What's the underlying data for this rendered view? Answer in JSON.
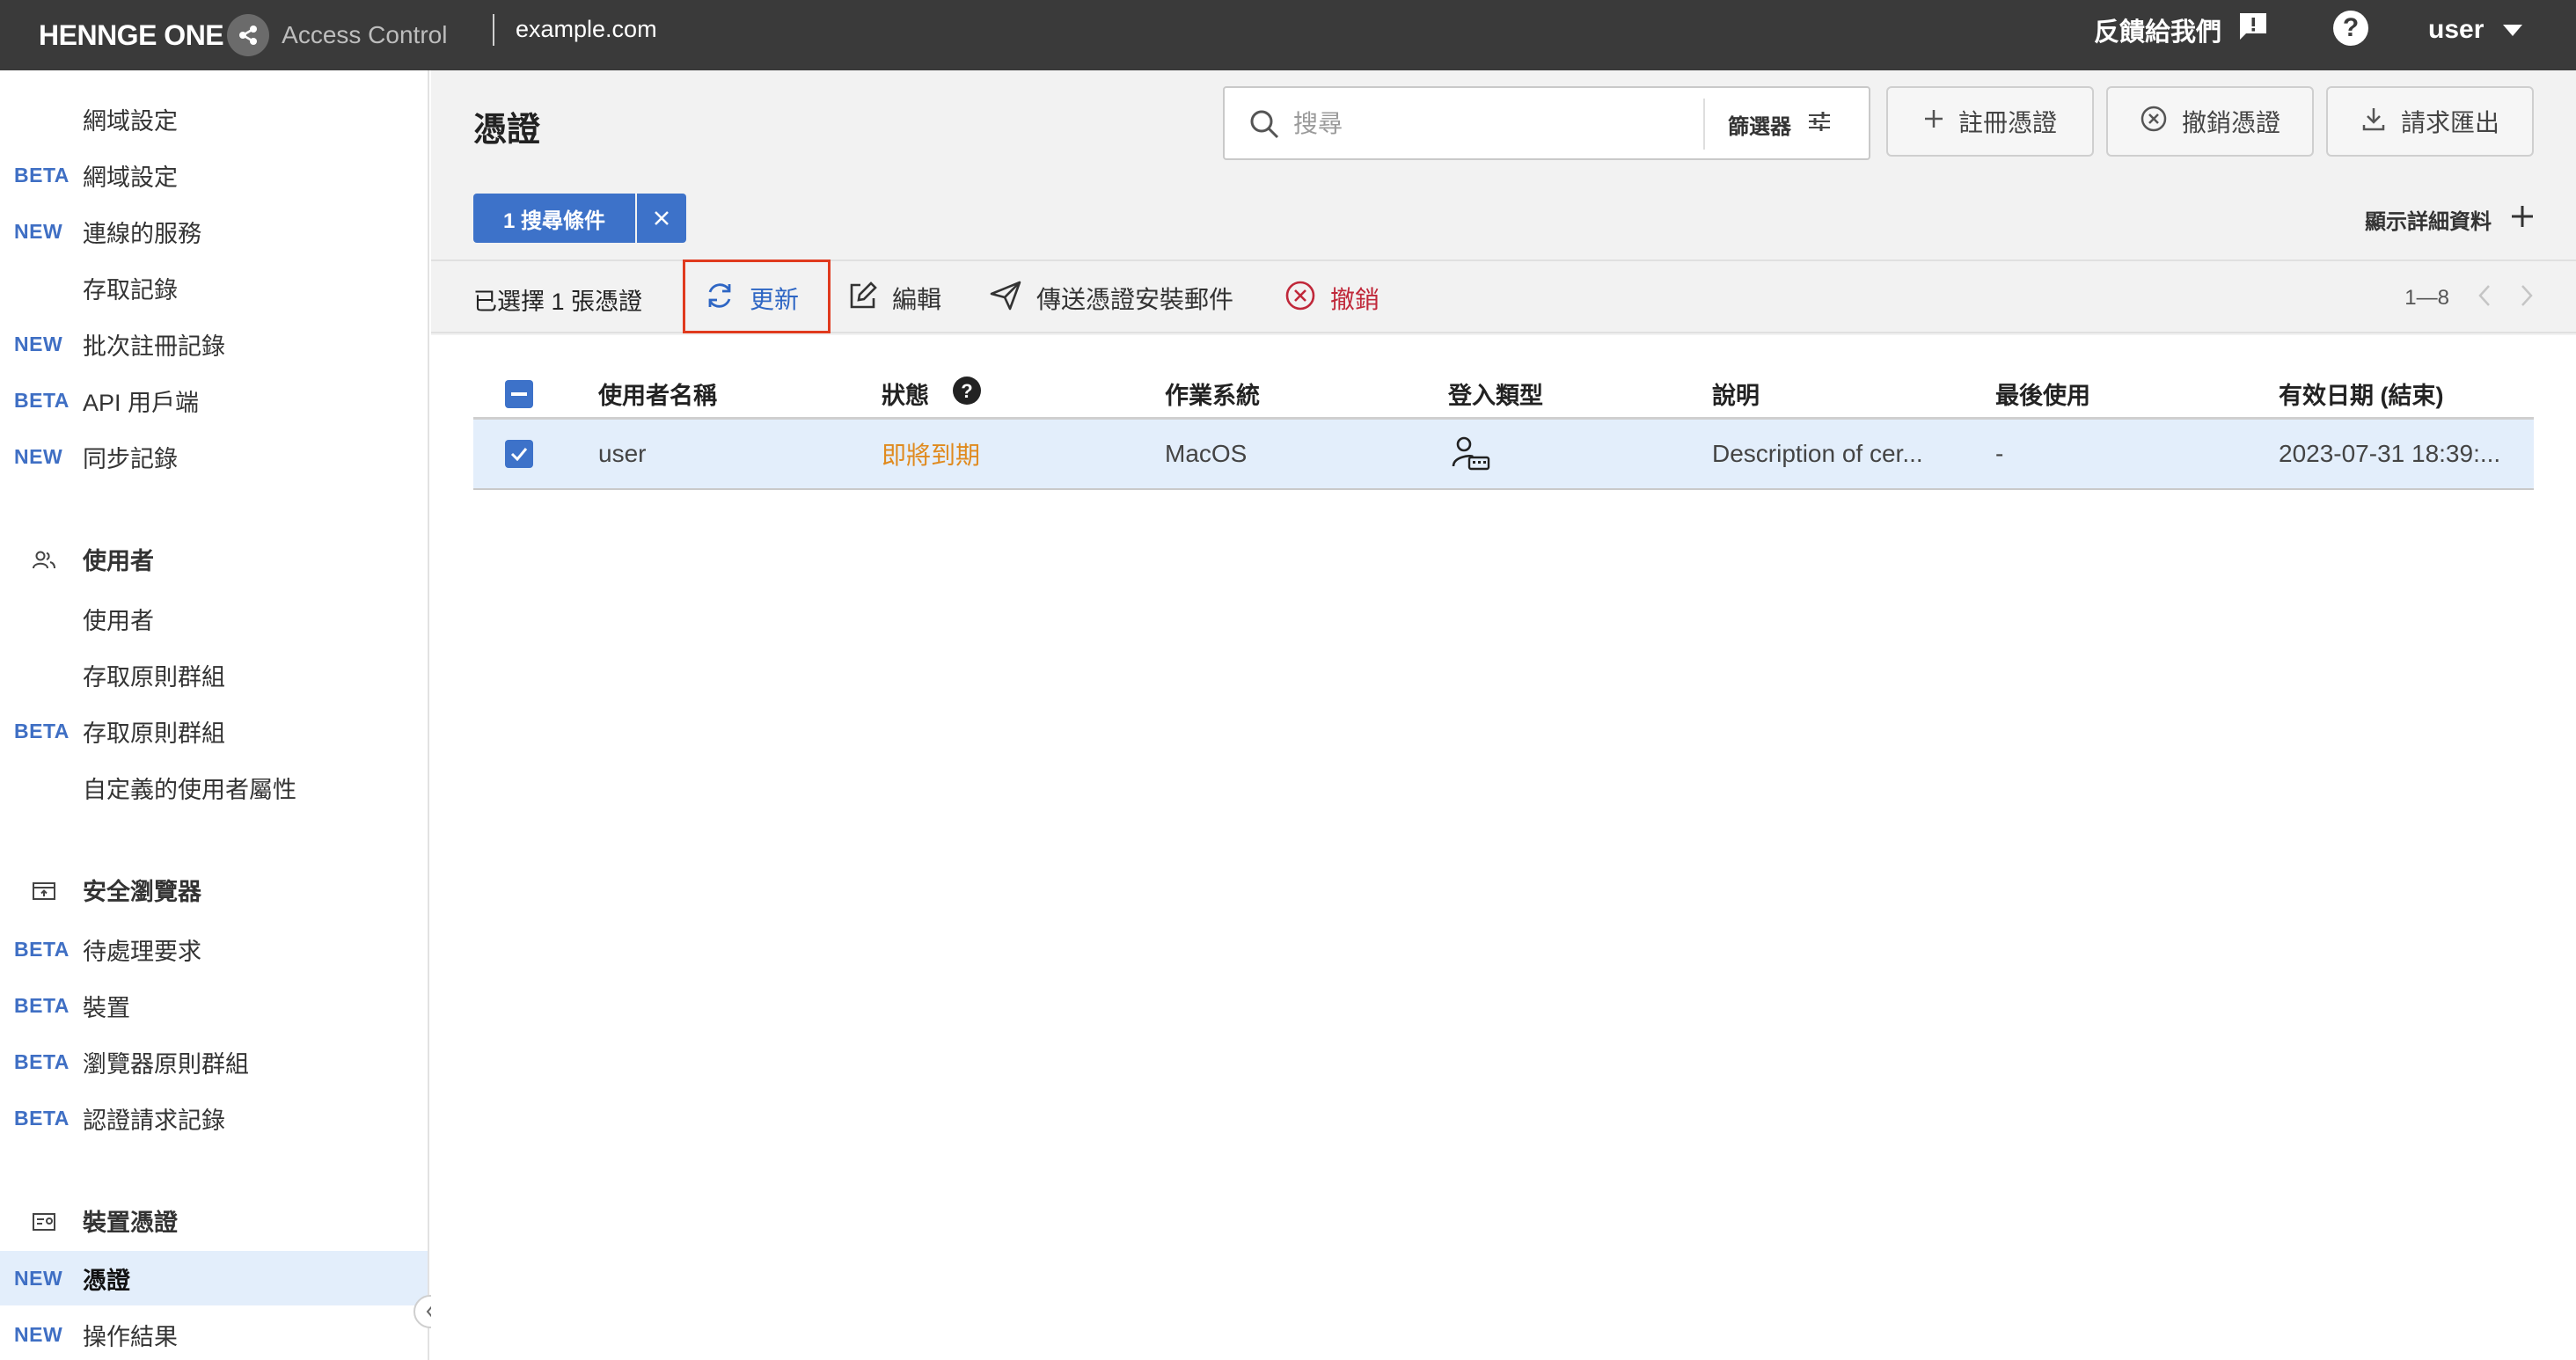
{
  "header": {
    "brand": "HENNGE ONE",
    "product": "Access Control",
    "domain": "example.com",
    "feedback_label": "反饋給我們",
    "user_label": "user"
  },
  "sidebar": {
    "items": [
      {
        "badge": "",
        "label": "網域設定"
      },
      {
        "badge": "BETA",
        "label": "網域設定"
      },
      {
        "badge": "NEW",
        "label": "連線的服務"
      },
      {
        "badge": "",
        "label": "存取記錄"
      },
      {
        "badge": "NEW",
        "label": "批次註冊記錄"
      },
      {
        "badge": "BETA",
        "label": "API 用戶端"
      },
      {
        "badge": "NEW",
        "label": "同步記錄"
      }
    ],
    "users_section": {
      "title": "使用者",
      "items": [
        {
          "badge": "",
          "label": "使用者"
        },
        {
          "badge": "",
          "label": "存取原則群組"
        },
        {
          "badge": "BETA",
          "label": "存取原則群組"
        },
        {
          "badge": "",
          "label": "自定義的使用者屬性"
        }
      ]
    },
    "browser_section": {
      "title": "安全瀏覽器",
      "items": [
        {
          "badge": "BETA",
          "label": "待處理要求"
        },
        {
          "badge": "BETA",
          "label": "裝置"
        },
        {
          "badge": "BETA",
          "label": "瀏覽器原則群組"
        },
        {
          "badge": "BETA",
          "label": "認證請求記錄"
        }
      ]
    },
    "cert_section": {
      "title": "裝置憑證",
      "items": [
        {
          "badge": "NEW",
          "label": "憑證",
          "active": true
        },
        {
          "badge": "NEW",
          "label": "操作結果"
        }
      ]
    }
  },
  "main": {
    "title": "憑證",
    "search_placeholder": "搜尋",
    "filter_label": "篩選器",
    "register_label": "註冊憑證",
    "revoke_cert_label": "撤銷憑證",
    "export_label": "請求匯出",
    "chip_label": "1 搜尋條件",
    "show_details_label": "顯示詳細資料",
    "selected_text": "已選擇 1 張憑證",
    "actions": {
      "renew": "更新",
      "edit": "編輯",
      "send_mail": "傳送憑證安裝郵件",
      "revoke": "撤銷"
    },
    "pagination": "1—8"
  },
  "table": {
    "columns": [
      "使用者名稱",
      "狀態",
      "作業系統",
      "登入類型",
      "說明",
      "最後使用",
      "有效日期 (結束)"
    ],
    "rows": [
      {
        "username": "user",
        "status": "即將到期",
        "os": "MacOS",
        "login_type_icon": "user-keyboard-icon",
        "description": "Description of cer...",
        "last_used": "-",
        "valid_until": "2023-07-31 18:39:..."
      }
    ]
  },
  "colors": {
    "topbar": "#3a3a3a",
    "accent": "#3d72c9",
    "badge": "#3f6fc4",
    "warning": "#e08a1e",
    "danger": "#c0283a",
    "highlight": "#e03a1e"
  }
}
